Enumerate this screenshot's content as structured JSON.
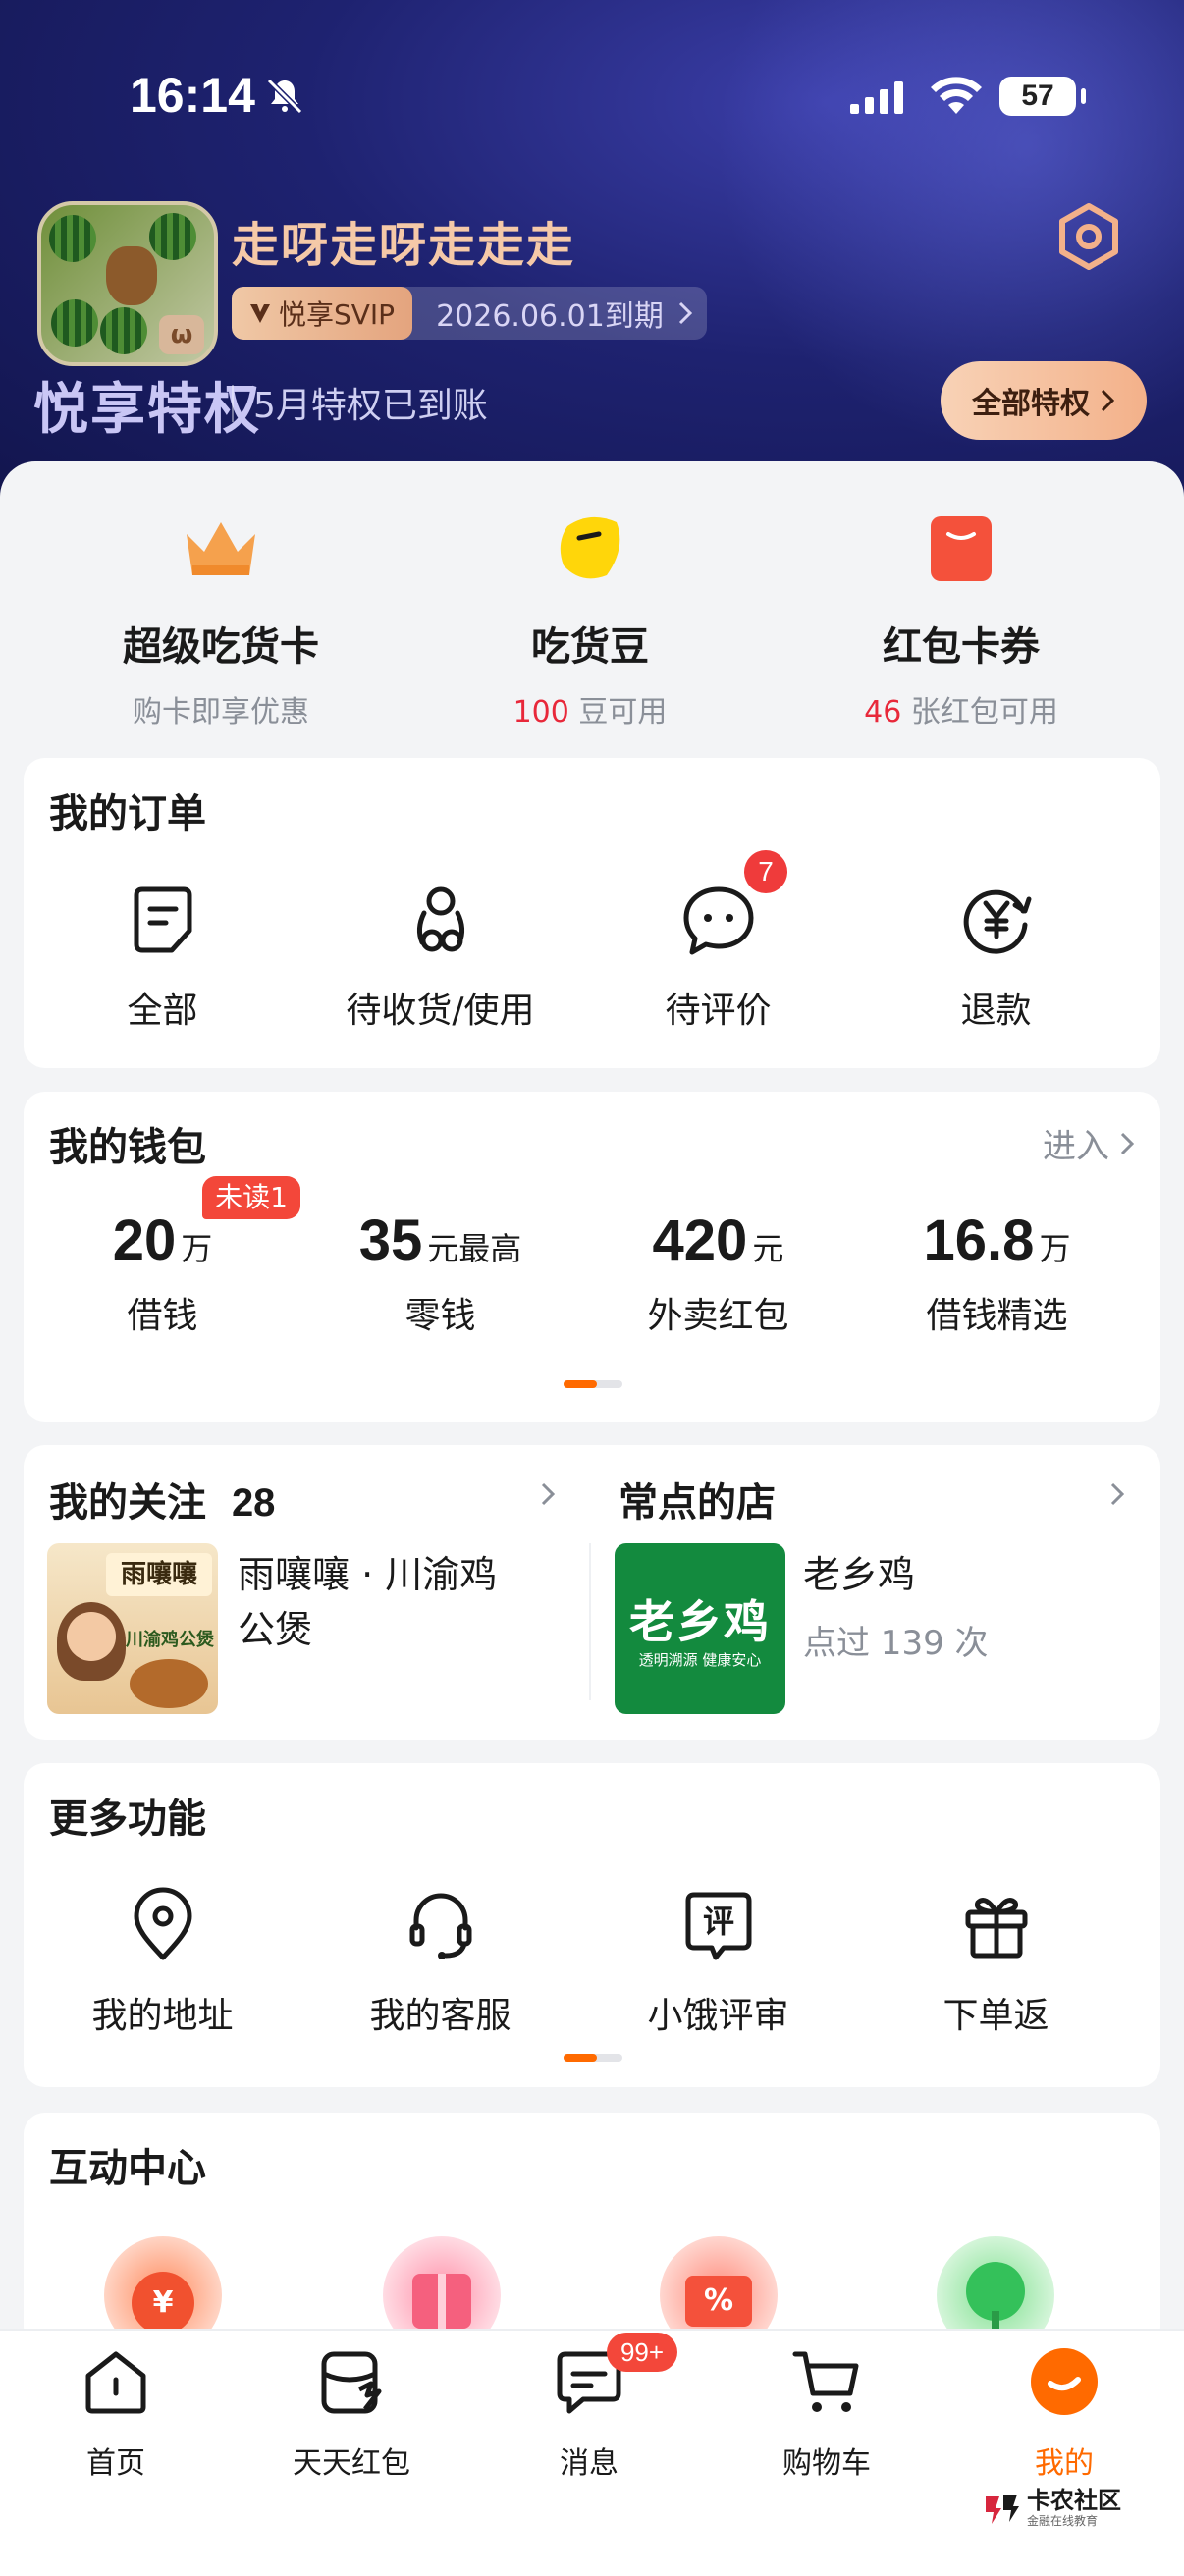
{
  "status_bar": {
    "time": "16:14",
    "battery": "57"
  },
  "profile": {
    "username": "走呀走呀走走走",
    "svip_label": "悦享SVIP",
    "svip_expiry": "2026.06.01到期",
    "privilege_title": "悦享特权",
    "privilege_text": "5月特权已到账",
    "all_privileges": "全部特权"
  },
  "top_features": [
    {
      "title": "超级吃货卡",
      "sub": "购卡即享优惠",
      "icon": "crown-icon"
    },
    {
      "title": "吃货豆",
      "sub_num": "100",
      "sub": "豆可用",
      "icon": "bean-icon"
    },
    {
      "title": "红包卡券",
      "sub_num": "46",
      "sub": "张红包可用",
      "icon": "red-envelope-icon"
    }
  ],
  "orders": {
    "title": "我的订单",
    "items": [
      {
        "label": "全部",
        "icon": "document-icon"
      },
      {
        "label": "待收货/使用",
        "icon": "delivery-scooter-icon"
      },
      {
        "label": "待评价",
        "icon": "chat-bubble-icon",
        "badge": "7"
      },
      {
        "label": "退款",
        "icon": "yuan-refund-icon"
      }
    ]
  },
  "wallet": {
    "title": "我的钱包",
    "link": "进入",
    "items": [
      {
        "value": "20",
        "unit": "万",
        "label": "借钱",
        "tag": "未读1"
      },
      {
        "value": "35",
        "unit": "元最高",
        "label": "零钱"
      },
      {
        "value": "420",
        "unit": "元",
        "label": "外卖红包"
      },
      {
        "value": "16.8",
        "unit": "万",
        "label": "借钱精选"
      }
    ]
  },
  "follow": {
    "title": "我的关注",
    "count": "28",
    "shop_name": "雨嚷嚷 · 川渝鸡公煲",
    "shop_img_title": "雨嚷嚷",
    "shop_img_sub": "川渝鸡公煲"
  },
  "frequent": {
    "title": "常点的店",
    "shop_name": "老乡鸡",
    "shop_sub": "点过 139 次",
    "logo_text": "老乡鸡",
    "logo_sub": "透明溯源 健康安心"
  },
  "more": {
    "title": "更多功能",
    "items": [
      {
        "label": "我的地址",
        "icon": "location-pin-icon"
      },
      {
        "label": "我的客服",
        "icon": "headset-icon"
      },
      {
        "label": "小饿评审",
        "icon": "review-icon",
        "icon_text": "评"
      },
      {
        "label": "下单返",
        "icon": "gift-icon"
      }
    ]
  },
  "interaction": {
    "title": "互动中心"
  },
  "tabbar": {
    "items": [
      {
        "label": "首页",
        "icon": "home-icon"
      },
      {
        "label": "天天红包",
        "icon": "red-packet-icon"
      },
      {
        "label": "消息",
        "icon": "message-icon",
        "badge": "99+"
      },
      {
        "label": "购物车",
        "icon": "cart-icon"
      },
      {
        "label": "我的",
        "icon": "profile-icon",
        "active": true
      }
    ]
  },
  "watermark": {
    "text": "卡农社区",
    "sub": "金融在线教育"
  },
  "colors": {
    "accent": "#ff6a00",
    "red": "#e8283a",
    "hero_bg": "#1e2270"
  }
}
